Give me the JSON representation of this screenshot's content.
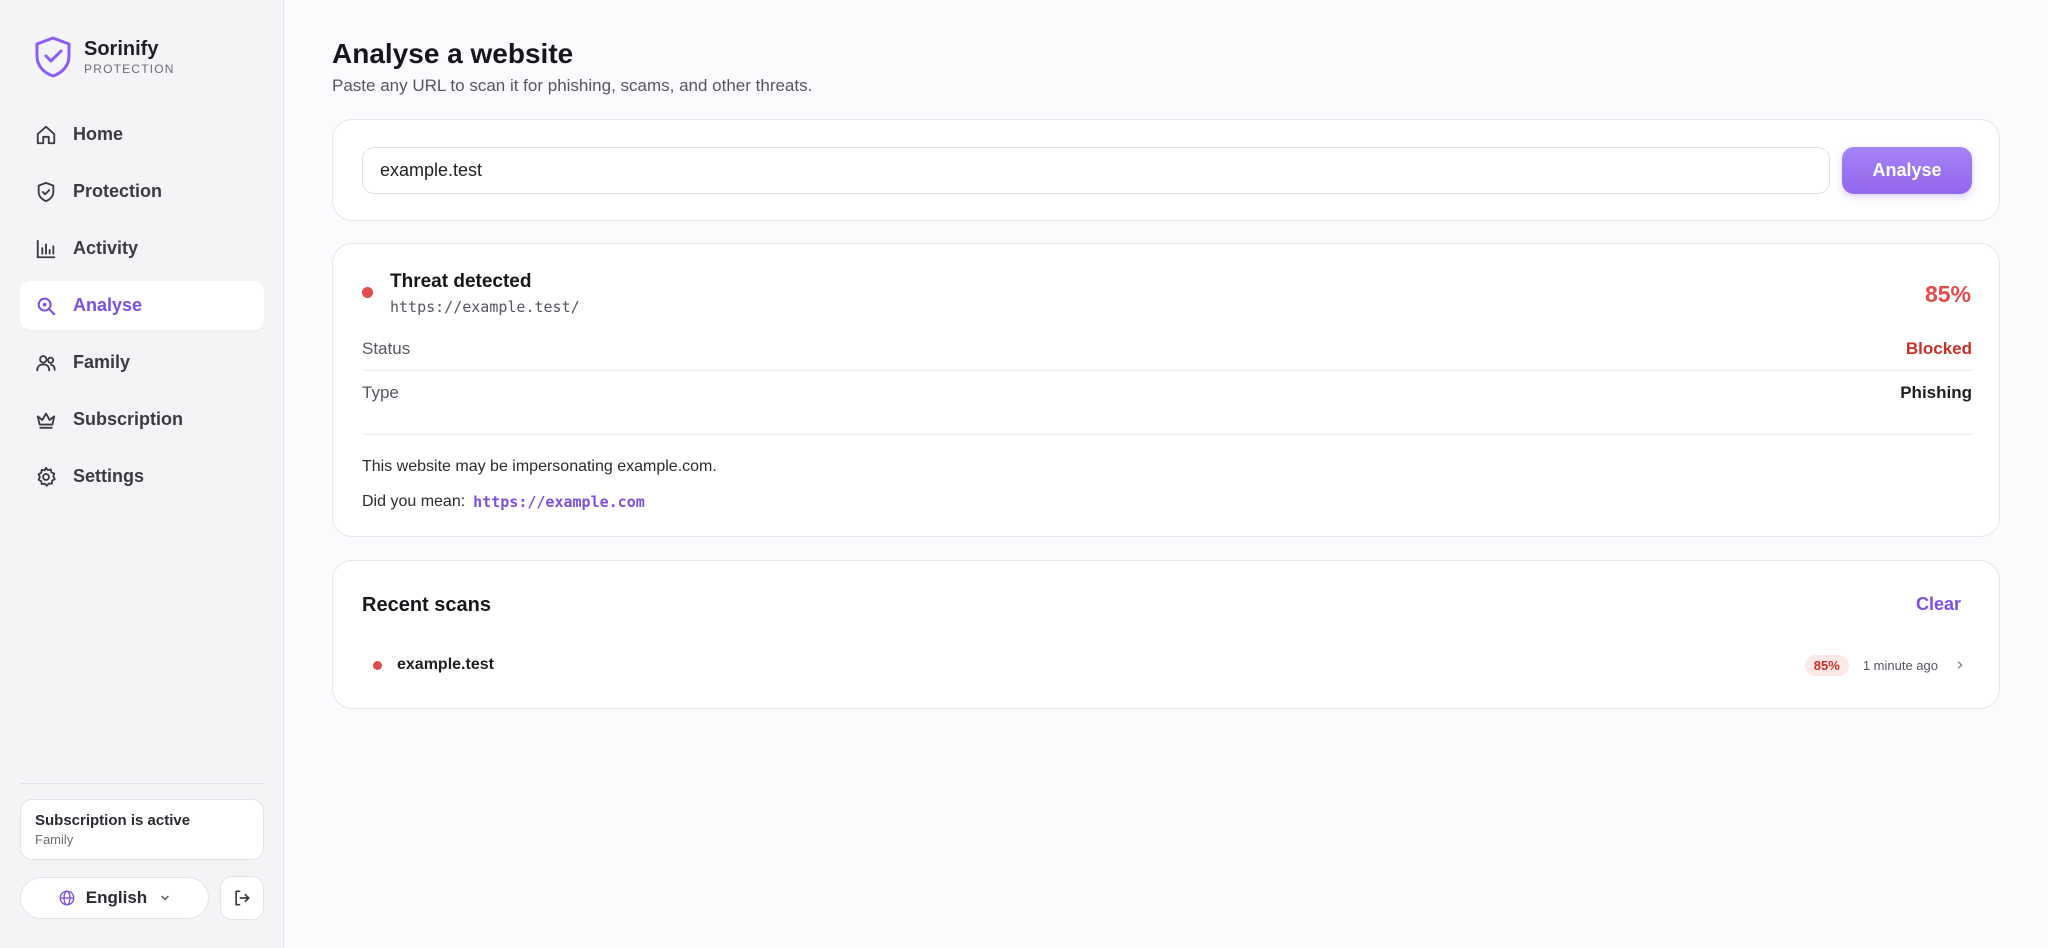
{
  "brand": {
    "name": "Sorinify",
    "subtitle": "PROTECTION",
    "logo_icon": "shield-check-icon",
    "accent": "#7c4fe0"
  },
  "sidebar": {
    "items": [
      {
        "label": "Home",
        "icon": "home-icon",
        "active": false
      },
      {
        "label": "Protection",
        "icon": "shield-icon",
        "active": false
      },
      {
        "label": "Activity",
        "icon": "bar-chart-icon",
        "active": false
      },
      {
        "label": "Analyse",
        "icon": "search-icon",
        "active": true
      },
      {
        "label": "Family",
        "icon": "users-icon",
        "active": false
      },
      {
        "label": "Subscription",
        "icon": "crown-icon",
        "active": false
      },
      {
        "label": "Settings",
        "icon": "gear-icon",
        "active": false
      }
    ],
    "subscription": {
      "status": "Subscription is active",
      "plan": "Family"
    },
    "language": {
      "label": "English",
      "icon": "globe-icon"
    },
    "logout_icon": "logout-icon"
  },
  "page": {
    "title": "Analyse a website",
    "subtitle": "Paste any URL to scan it for phishing, scams, and other threats."
  },
  "search": {
    "value": "example.test",
    "button_label": "Analyse"
  },
  "result": {
    "title": "Threat detected",
    "url": "https://example.test/",
    "score": "85%",
    "status_label": "Status",
    "status_value": "Blocked",
    "type_label": "Type",
    "type_value": "Phishing",
    "note": "This website may be impersonating example.com.",
    "did_you_mean_label": "Did you mean:",
    "did_you_mean_url": "https://example.com",
    "danger_color": "#e04b4b"
  },
  "recent": {
    "title": "Recent scans",
    "clear_label": "Clear",
    "items": [
      {
        "host": "example.test",
        "score": "85%",
        "time": "1 minute ago"
      }
    ]
  }
}
